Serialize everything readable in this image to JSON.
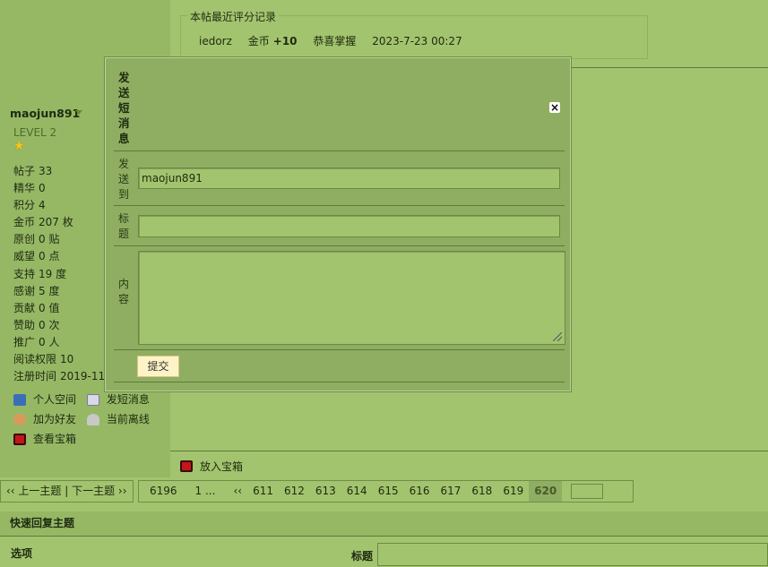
{
  "profile": {
    "username": "maojun891",
    "level": "LEVEL 2",
    "stats": [
      {
        "label": "帖子",
        "value": "33"
      },
      {
        "label": "精华",
        "value": "0"
      },
      {
        "label": "积分",
        "value": "4"
      },
      {
        "label": "金币",
        "value": "207 枚"
      },
      {
        "label": "原创",
        "value": "0 贴"
      },
      {
        "label": "威望",
        "value": "0 点"
      },
      {
        "label": "支持",
        "value": "19 度"
      },
      {
        "label": "感谢",
        "value": "5 度"
      },
      {
        "label": "贡献",
        "value": "0 值"
      },
      {
        "label": "赞助",
        "value": "0 次"
      },
      {
        "label": "推广",
        "value": "0 人"
      },
      {
        "label": "阅读权限",
        "value": "10"
      },
      {
        "label": "注册时间",
        "value": "2019-11"
      }
    ],
    "links": {
      "space": "个人空间",
      "pm": "发短消息",
      "friend": "加为好友",
      "status": "当前离线",
      "treasure": "查看宝箱"
    }
  },
  "rating": {
    "legend": "本帖最近评分记录",
    "user": "iedorz",
    "currency": "金币",
    "amount": "+10",
    "reason": "恭喜掌握",
    "time": "2023-7-23 00:27"
  },
  "dialog": {
    "title": "发送短消息",
    "close": "×",
    "to_label": "发送到",
    "to_value": "maojun891",
    "subject_label": "标题",
    "subject_value": "",
    "content_label": "内容",
    "submit": "提交"
  },
  "put_treasure": "放入宝箱",
  "nav": {
    "prev_next": "‹‹ 上一主题 | 下一主题 ››"
  },
  "pager": {
    "total": "6196",
    "first": "1 ...",
    "prev": "‹‹",
    "pages": [
      "611",
      "612",
      "613",
      "614",
      "615",
      "616",
      "617",
      "618",
      "619"
    ],
    "current": "620"
  },
  "quick_reply": {
    "title": "快速回复主题",
    "options": "选项",
    "subject_label": "标题"
  },
  "colors": {
    "background": "#a3c46e",
    "sidebar": "#96b865",
    "dialog": "#8fae62",
    "submit": "#fdf3c6"
  }
}
